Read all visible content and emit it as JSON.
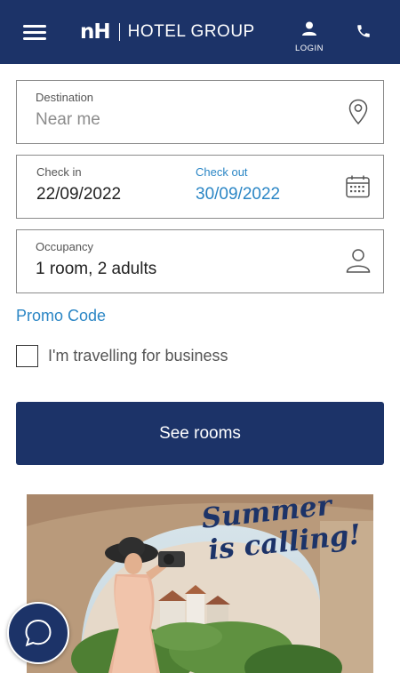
{
  "header": {
    "brand_mark": "nH",
    "brand_text": "HOTEL GROUP",
    "login_label": "LOGIN",
    "background": "#1c3368"
  },
  "search": {
    "destination": {
      "label": "Destination",
      "placeholder": "Near me",
      "icon": "location-pin-icon"
    },
    "check_in": {
      "label": "Check in",
      "value": "22/09/2022"
    },
    "check_out": {
      "label": "Check out",
      "value": "30/09/2022",
      "icon": "calendar-icon"
    },
    "occupancy": {
      "label": "Occupancy",
      "value": "1 room, 2 adults",
      "icon": "person-icon"
    },
    "promo_code_label": "Promo Code",
    "business_label": "I'm travelling for business",
    "business_checked": false,
    "submit_label": "See rooms"
  },
  "banner": {
    "title_line1": "Summer",
    "title_line2": "is calling!"
  },
  "colors": {
    "primary": "#1c3368",
    "accent": "#2b86c5"
  }
}
